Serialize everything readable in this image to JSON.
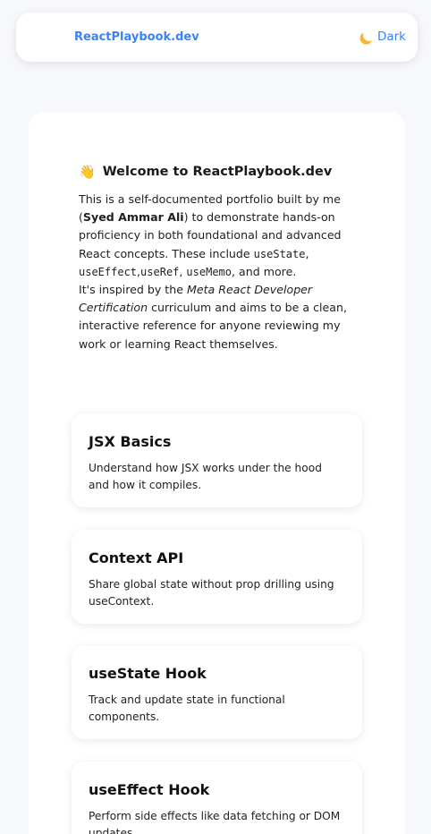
{
  "navbar": {
    "brand": "ReactPlaybook.dev",
    "theme_label": "Dark",
    "theme_icon": "moon-icon",
    "accent_color": "#3b82f6"
  },
  "intro": {
    "title": "Welcome to ReactPlaybook.dev",
    "title_icon": "wave-icon",
    "p1_a": "This is a self-documented portfolio built by me (",
    "author": "Syed Ammar Ali",
    "p1_b": ") to demonstrate hands-on proficiency in both foundational and advanced React concepts. These include ",
    "code1": "useState",
    "sep1": ", ",
    "code2": "useEffect",
    "sep2": ",",
    "code3": "useRef",
    "sep3": ", ",
    "code4": "useMemo",
    "p1_c": ", and more.",
    "p2_a": "It's inspired by the ",
    "p2_em": "Meta React Developer Certification",
    "p2_b": " curriculum and aims to be a clean, interactive reference for anyone reviewing my work or learning React themselves."
  },
  "topics": [
    {
      "title": "JSX Basics",
      "description": "Understand how JSX works under the hood and how it compiles."
    },
    {
      "title": "Context API",
      "description": "Share global state without prop drilling using useContext."
    },
    {
      "title": "useState Hook",
      "description": "Track and update state in functional components."
    },
    {
      "title": "useEffect Hook",
      "description": "Perform side effects like data fetching or DOM updates."
    }
  ]
}
